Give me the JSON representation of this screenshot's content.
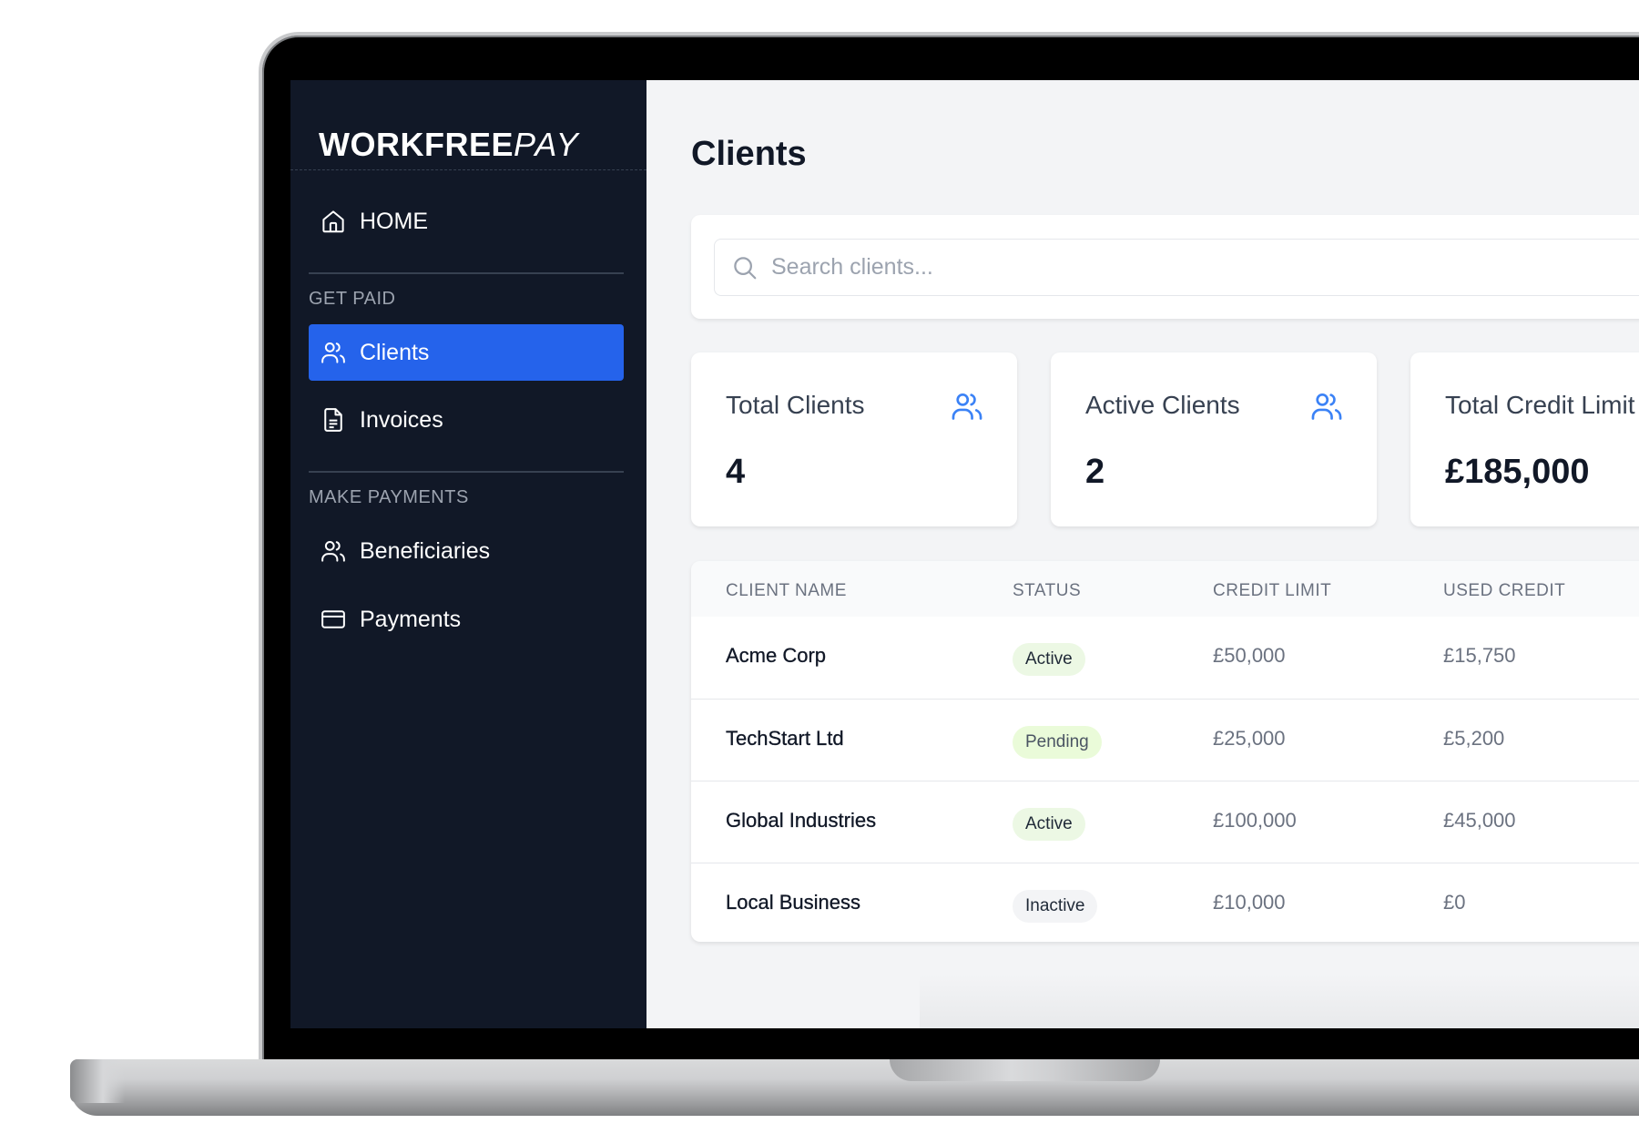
{
  "brand": {
    "name_bold": "WORKFREE",
    "name_light": "PAY"
  },
  "sidebar": {
    "home": {
      "label": "HOME",
      "icon": "home-icon"
    },
    "sections": [
      {
        "title": "GET PAID",
        "items": [
          {
            "label": "Clients",
            "icon": "users-icon",
            "active": true
          },
          {
            "label": "Invoices",
            "icon": "document-icon",
            "active": false
          }
        ]
      },
      {
        "title": "MAKE PAYMENTS",
        "items": [
          {
            "label": "Beneficiaries",
            "icon": "users-icon",
            "active": false
          },
          {
            "label": "Payments",
            "icon": "credit-card-icon",
            "active": false
          }
        ]
      }
    ]
  },
  "page": {
    "title": "Clients"
  },
  "search": {
    "placeholder": "Search clients...",
    "value": ""
  },
  "stats": [
    {
      "label": "Total Clients",
      "value": "4",
      "icon": "users-icon"
    },
    {
      "label": "Active Clients",
      "value": "2",
      "icon": "users-icon"
    },
    {
      "label": "Total Credit Limit",
      "value": "£185,000"
    }
  ],
  "table": {
    "columns": [
      "CLIENT NAME",
      "STATUS",
      "CREDIT LIMIT",
      "USED CREDIT"
    ],
    "rows": [
      {
        "name": "Acme Corp",
        "status": "Active",
        "credit_limit": "£50,000",
        "used_credit": "£15,750"
      },
      {
        "name": "TechStart Ltd",
        "status": "Pending",
        "credit_limit": "£25,000",
        "used_credit": "£5,200"
      },
      {
        "name": "Global Industries",
        "status": "Active",
        "credit_limit": "£100,000",
        "used_credit": "£45,000"
      },
      {
        "name": "Local Business",
        "status": "Inactive",
        "credit_limit": "£10,000",
        "used_credit": "£0"
      }
    ]
  },
  "colors": {
    "sidebar_bg": "#111827",
    "accent": "#2563eb",
    "stat_icon": "#3b82f6",
    "badge_active_bg": "#ecf8e4",
    "badge_pending_bg": "#eafbd9",
    "badge_inactive_bg": "#f3f4f6"
  }
}
